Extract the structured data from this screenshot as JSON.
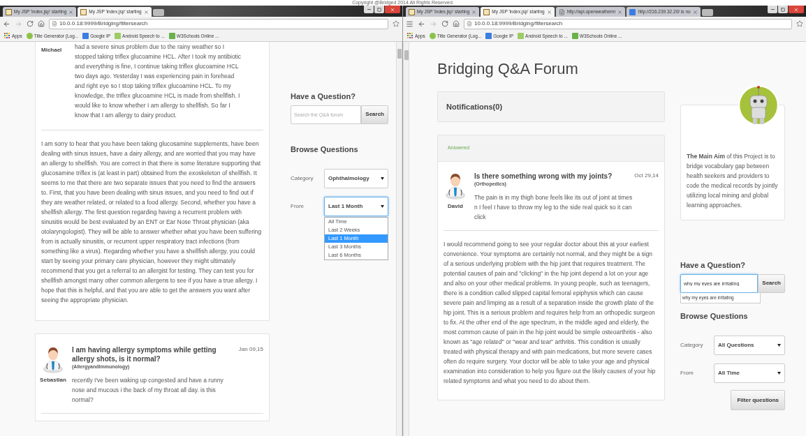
{
  "copyright": "Copyright @Bridged 2014 All Rights Reserved.",
  "left_window": {
    "tabs": [
      {
        "title": "My JSP 'index.jsp' starting",
        "selected": false
      },
      {
        "title": "My JSP 'index.jsp' starting",
        "selected": true
      }
    ],
    "url": "10.0.0.18:9999/Bridging/filtersearch",
    "bookmarks": [
      "Apps",
      "Title Generator (Log...",
      "Google IP",
      "Android Speech to ...",
      "W3Schools Online ..."
    ],
    "question_excerpt": {
      "author": "Michael",
      "text": "had a severe sinus problem due to the rainy weather so I stopped taking triflex glucoamine HCL. After I took my antibiotic and everything is fine, I continue taking triflex glucoamine HCL two days ago. Yesterday I was experiencing pain in forehead and right eye so I stop taking triflex glucoamine HCL. To my knowledge, the triflex glucoamine HCL is made from shellfish. I would like to know whether I am allergy to shellfish. So far I know that I am allergy to dairy product."
    },
    "answer": "I am sorry to hear that you have been taking glucosamine supplements, have been dealing with sinus issues, have a dairy allergy, and are worried that you may have an allergy to shellfish. You are correct in that there is some literature supporting that glucosamine triflex is (at least in part) obtained from the exoskeleton of shellfish. It seems to me that there are two separate issues that you need to find the answers to. First, that you have been dealing with sinus issues, and you need to find out if they are weather related, or related to a food allergy. Second, whether you have a shellfish allergy. The first question regarding having a recurrent problem with sinusitis would be best evaluated by an ENT or Ear Nose Throat physician (aka otolaryngologist). They will be able to answer whether what you have been suffering from is actually sinusitis, or recurrent upper respiratory tract infections (from something like a virus). Regarding whether you have a shellfish allergy, you could start by seeing your primary care physician, however they might ultimately recommend that you get a referral to an allergist for testing. They can test you for shellfish amongst many other common allergens to see if you have a true allergy. I hope that this is helpful, and that you are able to get the answers you want after seeing the appropriate physician.",
    "next_question": {
      "title": "I am having allergy symptoms while getting allergy shots, is it normal?",
      "date": "Jan 09,15",
      "category": "(AllergyandImmunology)",
      "text": "recently I've been waking up congested and have a runny nose and mucous i the back of my throat all day. is this normal?",
      "author": "Sebastian"
    },
    "sidebar": {
      "search_heading": "Have a Question?",
      "search": {
        "placeholder": "Search the Q&A forum",
        "focused": false
      },
      "search_button": "Search",
      "browse_heading": "Browse Questions",
      "category": {
        "label": "Category",
        "value": "Ophthalmology",
        "expanded": false
      },
      "from": {
        "label": "From",
        "value": "Last 1 Month",
        "expanded": true,
        "options": [
          {
            "label": "All Time",
            "selected": false
          },
          {
            "label": "Last 2 Weeks",
            "selected": false
          },
          {
            "label": "Last 1 Month",
            "selected": true
          },
          {
            "label": "Last 3 Months",
            "selected": false
          },
          {
            "label": "Last 6 Months",
            "selected": false
          }
        ]
      }
    }
  },
  "right_window": {
    "menu_button": true,
    "tabs": [
      {
        "title": "My JSP 'index.jsp' starting",
        "selected": false
      },
      {
        "title": "My JSP 'index.jsp' starting",
        "selected": true
      },
      {
        "title": "http://api.openweatherm",
        "selected": false
      },
      {
        "title": "http://216.239.32.20/ is no",
        "selected": false
      }
    ],
    "url": "10.0.0.18:9999/Bridging/filtersearch",
    "bookmarks": [
      "Apps",
      "Title Generator (Log...",
      "Google IP",
      "Android Speech to ...",
      "W3Schools Online ..."
    ],
    "title": "Bridging Q&A Forum",
    "notifications": "Notifications(0)",
    "question": {
      "status": "Answered",
      "title": "Is there something wrong with my joints?",
      "date": "Oct 29,14",
      "category": "(Orthopedics)",
      "text": "The pain is in my thigh bone feels like its out of joint at times n I feel I have to throw my leg to the side real quick so it can click",
      "author": "David"
    },
    "answer": "I would recommend going to see your regular doctor about this at your earliest convenience. Your symptoms are certainly not normal, and they might be a sign of a serious underlying problem with the hip joint that requires treatment. The potential causes of pain and \"clicking\" in the hip joint depend a lot on your age and also on your other medical problems. In young people, such as teenagers, there is a condition called slipped capital femoral epiphysis which can cause severe pain and limping as a result of a separation inside the growth plate of the hip joint. This is a serious problem and requires help from an orthopedic surgeon to fix. At the other end of the age spectrum, in the middle aged and elderly, the most common cause of pain in the hip joint would be simple osteoarthritis - also known as \"age related\" or \"wear and tear\" arthritis. This condition is usually treated with physical therapy and with pain medications, but more severe cases often do require surgery. Your doctor will be able to take your age and physical examination into consideration to help you figure out the likely causes of your hip related symptoms and what you need to do about them.",
    "about": "**The Main Aim** of this Project is to bridge vocabulary gap between health seekers and providers to code the medical records by jointly utilizing local mining and global learning approaches.",
    "sidebar": {
      "search_heading": "Have a Question?",
      "search": {
        "value": "why my eyes are irritating",
        "focused": true
      },
      "search_button": "Search",
      "suggestions": [
        "why my eyes are irritating"
      ],
      "browse_heading": "Browse Questions",
      "category": {
        "label": "Category",
        "value": "All Questions",
        "expanded": false
      },
      "from": {
        "label": "From",
        "value": "All Time",
        "expanded": false
      },
      "filter_button": "Filter questions"
    }
  }
}
